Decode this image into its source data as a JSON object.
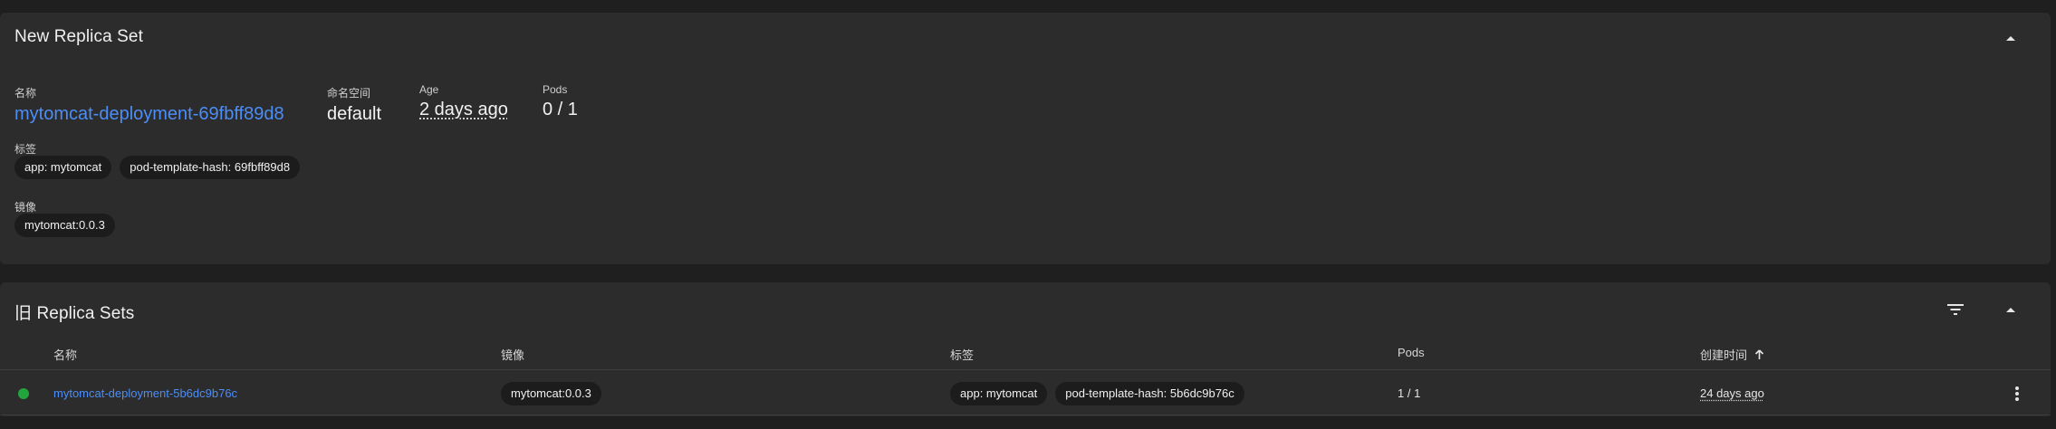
{
  "new_replica_set": {
    "title": "New Replica Set",
    "name_label": "名称",
    "name_value": "mytomcat-deployment-69fbff89d8",
    "namespace_label": "命名空间",
    "namespace_value": "default",
    "age_label": "Age",
    "age_value": "2 days ago",
    "pods_label": "Pods",
    "pods_value": "0 / 1",
    "labels_label": "标签",
    "labels": [
      "app: mytomcat",
      "pod-template-hash: 69fbff89d8"
    ],
    "images_label": "镜像",
    "images": [
      "mytomcat:0.0.3"
    ]
  },
  "old_replica_sets": {
    "title": "旧 Replica Sets",
    "columns": {
      "name": "名称",
      "image": "镜像",
      "labels": "标签",
      "pods": "Pods",
      "created": "创建时间"
    },
    "rows": [
      {
        "status": "running",
        "name": "mytomcat-deployment-5b6dc9b76c",
        "image": "mytomcat:0.0.3",
        "labels": [
          "app: mytomcat",
          "pod-template-hash: 5b6dc9b76c"
        ],
        "pods": "1 / 1",
        "created": "24 days ago"
      }
    ]
  },
  "icons": {
    "collapse": "chevron-up-icon",
    "filter": "filter-list-icon",
    "sort": "arrow-up-icon",
    "more": "more-vert-icon"
  },
  "colors": {
    "background": "#1f1f1f",
    "card": "#2c2c2c",
    "link": "#4c8df6",
    "status_ok": "#22a53c",
    "chip": "#1c1c1c"
  }
}
